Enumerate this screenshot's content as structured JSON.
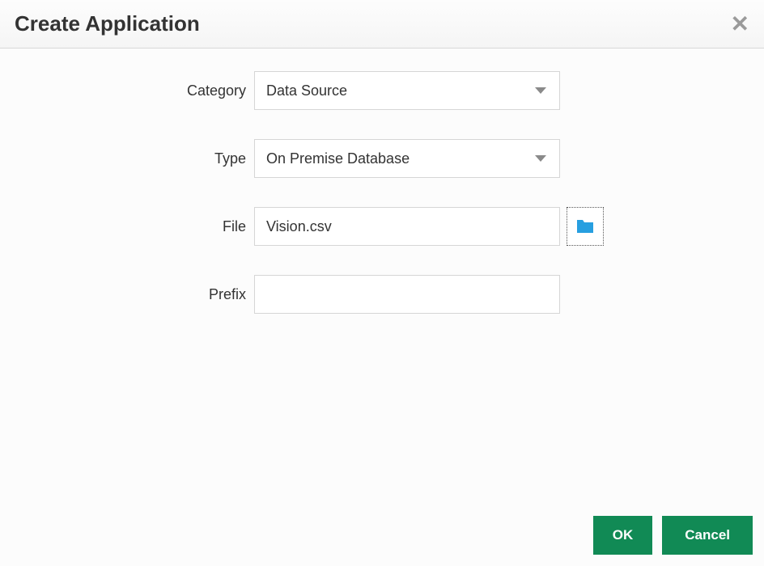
{
  "dialog": {
    "title": "Create Application",
    "fields": {
      "category": {
        "label": "Category",
        "value": "Data Source"
      },
      "type": {
        "label": "Type",
        "value": "On Premise Database"
      },
      "file": {
        "label": "File",
        "value": "Vision.csv"
      },
      "prefix": {
        "label": "Prefix",
        "value": ""
      }
    },
    "buttons": {
      "ok": "OK",
      "cancel": "Cancel"
    }
  }
}
